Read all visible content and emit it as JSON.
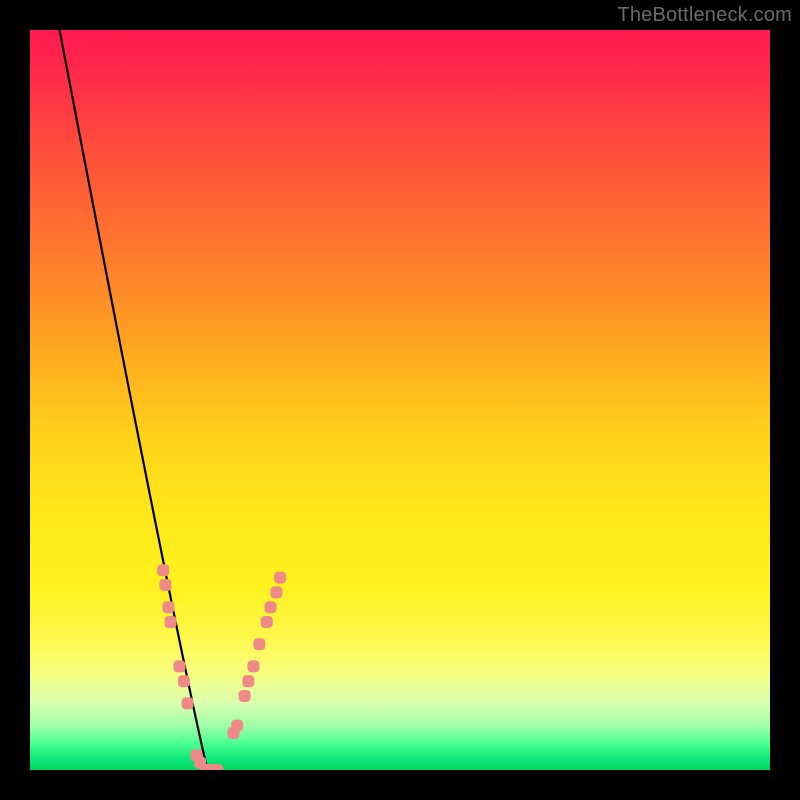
{
  "watermark": "TheBottleneck.com",
  "gradient": {
    "stops": [
      {
        "offset": 0.0,
        "color": "#ff1a50"
      },
      {
        "offset": 0.06,
        "color": "#ff2a4a"
      },
      {
        "offset": 0.15,
        "color": "#ff4a3c"
      },
      {
        "offset": 0.25,
        "color": "#ff6a32"
      },
      {
        "offset": 0.35,
        "color": "#ff8a28"
      },
      {
        "offset": 0.45,
        "color": "#ffae1e"
      },
      {
        "offset": 0.55,
        "color": "#ffd21a"
      },
      {
        "offset": 0.65,
        "color": "#ffe71a"
      },
      {
        "offset": 0.75,
        "color": "#fff21e"
      },
      {
        "offset": 0.82,
        "color": "#fff84a"
      },
      {
        "offset": 0.87,
        "color": "#f6ff80"
      },
      {
        "offset": 0.91,
        "color": "#d8ffb0"
      },
      {
        "offset": 0.94,
        "color": "#a0ffa8"
      },
      {
        "offset": 0.965,
        "color": "#48ff90"
      },
      {
        "offset": 0.985,
        "color": "#10e878"
      },
      {
        "offset": 1.0,
        "color": "#00d662"
      }
    ]
  },
  "chart_data": {
    "type": "line",
    "title": "",
    "xlabel": "",
    "ylabel": "",
    "xlim": [
      0,
      100
    ],
    "ylim": [
      0,
      100
    ],
    "x_valley": 24,
    "notes": "V-shaped bottleneck curve reaching zero near x≈24; sparse pink markers cluster along the curve near the valley.",
    "series": [
      {
        "name": "bottleneck-curve",
        "samples": [
          {
            "x": 5,
            "y": 100
          },
          {
            "x": 8,
            "y": 85
          },
          {
            "x": 11,
            "y": 68
          },
          {
            "x": 14,
            "y": 50
          },
          {
            "x": 17,
            "y": 33
          },
          {
            "x": 19,
            "y": 22
          },
          {
            "x": 21,
            "y": 11
          },
          {
            "x": 22,
            "y": 5
          },
          {
            "x": 23,
            "y": 1
          },
          {
            "x": 24,
            "y": 0
          },
          {
            "x": 25,
            "y": 0
          },
          {
            "x": 26,
            "y": 1
          },
          {
            "x": 28,
            "y": 6
          },
          {
            "x": 30,
            "y": 13
          },
          {
            "x": 33,
            "y": 23
          },
          {
            "x": 37,
            "y": 34
          },
          {
            "x": 42,
            "y": 45
          },
          {
            "x": 48,
            "y": 55
          },
          {
            "x": 55,
            "y": 63
          },
          {
            "x": 63,
            "y": 70
          },
          {
            "x": 72,
            "y": 76
          },
          {
            "x": 82,
            "y": 81
          },
          {
            "x": 92,
            "y": 85
          },
          {
            "x": 100,
            "y": 87
          }
        ]
      }
    ],
    "markers": [
      {
        "x": 18.0,
        "y": 27
      },
      {
        "x": 18.3,
        "y": 25
      },
      {
        "x": 18.7,
        "y": 22
      },
      {
        "x": 19.0,
        "y": 20
      },
      {
        "x": 20.2,
        "y": 14
      },
      {
        "x": 20.8,
        "y": 12
      },
      {
        "x": 21.3,
        "y": 9
      },
      {
        "x": 22.5,
        "y": 2
      },
      {
        "x": 23.0,
        "y": 1
      },
      {
        "x": 23.7,
        "y": 0
      },
      {
        "x": 24.5,
        "y": 0
      },
      {
        "x": 25.3,
        "y": 0
      },
      {
        "x": 27.5,
        "y": 5
      },
      {
        "x": 28.0,
        "y": 6
      },
      {
        "x": 29.0,
        "y": 10
      },
      {
        "x": 29.5,
        "y": 12
      },
      {
        "x": 30.2,
        "y": 14
      },
      {
        "x": 31.0,
        "y": 17
      },
      {
        "x": 32.0,
        "y": 20
      },
      {
        "x": 32.5,
        "y": 22
      },
      {
        "x": 33.3,
        "y": 24
      },
      {
        "x": 33.8,
        "y": 26
      }
    ]
  }
}
